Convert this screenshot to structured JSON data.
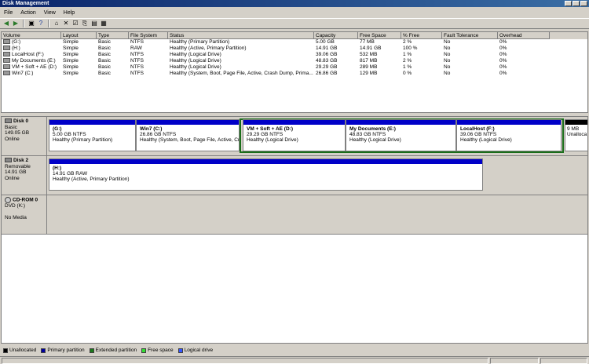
{
  "window": {
    "title": "Disk Management"
  },
  "menu": [
    "File",
    "Action",
    "View",
    "Help"
  ],
  "toolbar": [
    "back-icon",
    "forward-icon",
    "separator",
    "up-icon",
    "help-icon",
    "separator",
    "drive-icon",
    "delete-icon",
    "properties-icon",
    "open-icon",
    "explore-icon",
    "refresh-icon"
  ],
  "volume_list": {
    "columns": [
      "Volume",
      "Layout",
      "Type",
      "File System",
      "Status",
      "Capacity",
      "Free Space",
      "% Free",
      "Fault Tolerance",
      "Overhead"
    ],
    "rows": [
      [
        "(G:)",
        "Simple",
        "Basic",
        "NTFS",
        "Healthy (Primary Partition)",
        "5.00 GB",
        "77 MB",
        "2 %",
        "No",
        "0%"
      ],
      [
        "(H:)",
        "Simple",
        "Basic",
        "RAW",
        "Healthy (Active, Primary Partition)",
        "14.91 GB",
        "14.91 GB",
        "100 %",
        "No",
        "0%"
      ],
      [
        "LocalHost (F:)",
        "Simple",
        "Basic",
        "NTFS",
        "Healthy (Logical Drive)",
        "39.06 GB",
        "532 MB",
        "1 %",
        "No",
        "0%"
      ],
      [
        "My Documents (E:)",
        "Simple",
        "Basic",
        "NTFS",
        "Healthy (Logical Drive)",
        "48.83 GB",
        "817 MB",
        "2 %",
        "No",
        "0%"
      ],
      [
        "VM + Soft + AE (D:)",
        "Simple",
        "Basic",
        "NTFS",
        "Healthy (Logical Drive)",
        "29.29 GB",
        "289 MB",
        "1 %",
        "No",
        "0%"
      ],
      [
        "Win7 (C:)",
        "Simple",
        "Basic",
        "NTFS",
        "Healthy (System, Boot, Page File, Active, Crash Dump, Prima...",
        "26.86 GB",
        "129 MB",
        "0 %",
        "No",
        "0%"
      ]
    ]
  },
  "disks": [
    {
      "name": "Disk 0",
      "type": "Basic",
      "size": "149.05 GB",
      "state": "Online",
      "partitions": [
        {
          "name": "(G:)",
          "size": "5.00 GB NTFS",
          "status": "Healthy (Primary Partition)",
          "kind": "primary"
        },
        {
          "name": "Win7  (C:)",
          "size": "26.86 GB NTFS",
          "status": "Healthy (System, Boot, Page File, Active, Cr",
          "kind": "primary"
        },
        {
          "name": "VM + Soft + AE  (D:)",
          "size": "29.29 GB NTFS",
          "status": "Healthy (Logical Drive)",
          "kind": "logical"
        },
        {
          "name": "My Documents  (E:)",
          "size": "48.83 GB NTFS",
          "status": "Healthy (Logical Drive)",
          "kind": "logical"
        },
        {
          "name": "LocalHost  (F:)",
          "size": "39.06 GB NTFS",
          "status": "Healthy (Logical Drive)",
          "kind": "logical"
        },
        {
          "name": "",
          "size": "9 MB",
          "status": "Unalloca",
          "kind": "unallocated"
        }
      ]
    },
    {
      "name": "Disk 2",
      "type": "Removable",
      "size": "14.91 GB",
      "state": "Online",
      "partitions": [
        {
          "name": "(H:)",
          "size": "14.91 GB RAW",
          "status": "Healthy (Active, Primary Partition)",
          "kind": "primary"
        }
      ]
    },
    {
      "name": "CD-ROM 0",
      "type": "DVD (K:)",
      "size": "",
      "state": "No Media",
      "partitions": []
    }
  ],
  "legend": [
    {
      "label": "Unallocated",
      "color": "#000000"
    },
    {
      "label": "Primary partition",
      "color": "#0000a0"
    },
    {
      "label": "Extended partition",
      "color": "#1a7a1a"
    },
    {
      "label": "Free space",
      "color": "#33dd33"
    },
    {
      "label": "Logical drive",
      "color": "#3355ff"
    }
  ]
}
